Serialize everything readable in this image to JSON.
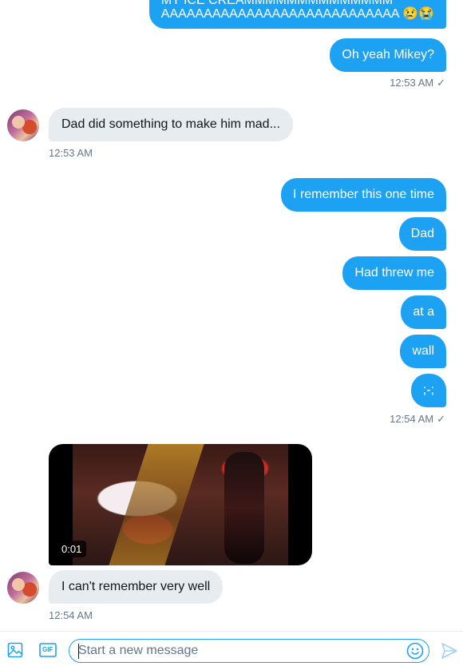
{
  "conversation": {
    "messages_out_1": {
      "line1": "MY ICE CREAMMMMMMMMMMMMMM",
      "line2": "AAAAAAAAAAAAAAAAAAAAAAAAAAAA 😢😭"
    },
    "msg_oh_yeah": "Oh yeah Mikey?",
    "ts_1": "12:53 AM",
    "msg_dad_did": "Dad did something to make him mad...",
    "ts_2": "12:53 AM",
    "msg_remember": "I remember this one time",
    "msg_dad": "Dad",
    "msg_had_threw": "Had threw me",
    "msg_at_a": "at a",
    "msg_wall": "wall",
    "msg_emote": ";-;",
    "ts_3": "12:54 AM",
    "video_duration": "0:01",
    "msg_cant_remember": "I can't remember very well",
    "ts_4": "12:54 AM",
    "read_check": "✓"
  },
  "composer": {
    "placeholder": "Start a new message",
    "gif_label": "GIF"
  },
  "colors": {
    "accent": "#1da1f2",
    "incoming_bubble": "#e6ecf0",
    "timestamp": "#657786"
  },
  "icons": [
    "image-icon",
    "gif-icon",
    "emoji-icon",
    "send-icon"
  ]
}
